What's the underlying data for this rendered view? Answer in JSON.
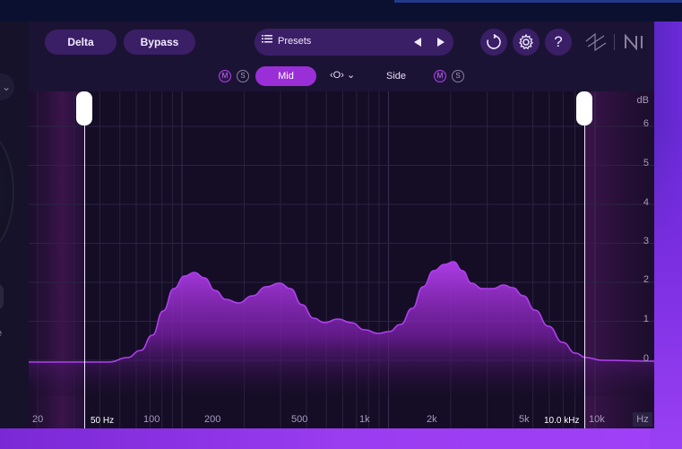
{
  "header": {
    "delta_label": "Delta",
    "bypass_label": "Bypass",
    "presets_label": "Presets",
    "help_label": "?"
  },
  "midside": {
    "mid_label": "Mid",
    "side_label": "Side",
    "m_badge": "M",
    "s_badge": "S",
    "link_symbol": "‹O›"
  },
  "graph": {
    "db_unit": "dB",
    "db_ticks": [
      "6",
      "5",
      "4",
      "3",
      "2",
      "1",
      "0"
    ],
    "freq_ticks": [
      "20",
      "100",
      "200",
      "500",
      "1k",
      "2k",
      "5k",
      "10k"
    ],
    "hz_unit": "Hz",
    "low_cut_label": "50 Hz",
    "high_cut_label": "10.0 kHz"
  },
  "colors": {
    "accent": "#9a2fd8",
    "curve": "#b040f0",
    "background": "#1b1334"
  },
  "left_panel": {
    "letter": "e"
  }
}
